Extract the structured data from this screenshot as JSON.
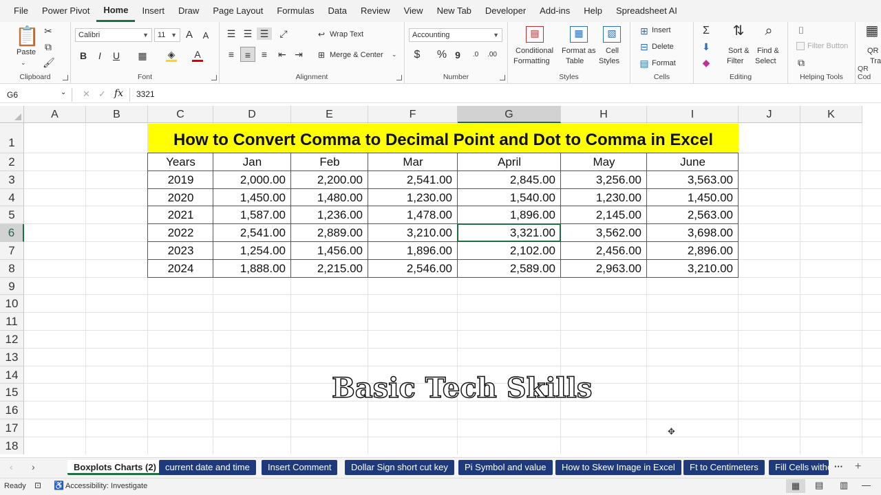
{
  "menu": [
    "File",
    "Power Pivot",
    "Home",
    "Insert",
    "Draw",
    "Page Layout",
    "Formulas",
    "Data",
    "Review",
    "View",
    "New Tab",
    "Developer",
    "Add-ins",
    "Help",
    "Spreadsheet AI"
  ],
  "menu_active": "Home",
  "ribbon": {
    "clipboard": {
      "paste": "Paste",
      "label": "Clipboard"
    },
    "font": {
      "name": "Calibri",
      "size": "11",
      "label": "Font",
      "bold": "B",
      "italic": "I",
      "underline": "U",
      "grow": "A",
      "shrink": "A"
    },
    "alignment": {
      "wrap": "Wrap Text",
      "merge": "Merge & Center",
      "label": "Alignment"
    },
    "number": {
      "format": "Accounting",
      "dollar": "$",
      "percent": "%",
      "comma": "9",
      "label": "Number"
    },
    "styles": {
      "conditional_1": "Conditional",
      "conditional_2": "Formatting",
      "format_table_1": "Format as",
      "format_table_2": "Table",
      "cell_styles_1": "Cell",
      "cell_styles_2": "Styles",
      "label": "Styles"
    },
    "cells": {
      "insert": "Insert",
      "delete": "Delete",
      "format": "Format",
      "label": "Cells"
    },
    "editing": {
      "sort_1": "Sort &",
      "sort_2": "Filter",
      "find_1": "Find &",
      "find_2": "Select",
      "label": "Editing"
    },
    "helping": {
      "filter_button": "Filter Button",
      "label": "Helping Tools"
    },
    "qr": {
      "label": "QR Cod",
      "btn_1": "QR",
      "btn_2": "Tra"
    }
  },
  "formula_bar": {
    "name_box": "G6",
    "fx": "fx",
    "value": "3321"
  },
  "columns": [
    "A",
    "B",
    "C",
    "D",
    "E",
    "F",
    "G",
    "H",
    "I",
    "J",
    "K"
  ],
  "rows": [
    "1",
    "2",
    "3",
    "4",
    "5",
    "6",
    "7",
    "8",
    "9",
    "10",
    "11",
    "12",
    "13",
    "14",
    "15",
    "16",
    "17",
    "18"
  ],
  "selected_col": "G",
  "selected_row": "6",
  "sheet": {
    "title": "How to Convert Comma to Decimal Point and Dot to Comma in Excel",
    "headers": [
      "Years",
      "Jan",
      "Feb",
      "Mar",
      "April",
      "May",
      "June"
    ],
    "data": [
      [
        "2019",
        "2,000.00",
        "2,200.00",
        "2,541.00",
        "2,845.00",
        "3,256.00",
        "3,563.00"
      ],
      [
        "2020",
        "1,450.00",
        "1,480.00",
        "1,230.00",
        "1,540.00",
        "1,230.00",
        "1,450.00"
      ],
      [
        "2021",
        "1,587.00",
        "1,236.00",
        "1,478.00",
        "1,896.00",
        "2,145.00",
        "2,563.00"
      ],
      [
        "2022",
        "2,541.00",
        "2,889.00",
        "3,210.00",
        "3,321.00",
        "3,562.00",
        "3,698.00"
      ],
      [
        "2023",
        "1,254.00",
        "1,456.00",
        "1,896.00",
        "2,102.00",
        "2,456.00",
        "2,896.00"
      ],
      [
        "2024",
        "1,888.00",
        "2,215.00",
        "2,546.00",
        "2,589.00",
        "2,963.00",
        "3,210.00"
      ]
    ]
  },
  "watermark": "Basic Tech Skills",
  "tabs": [
    "Boxplots Charts (2)",
    "current date and time",
    "Insert Comment",
    "Dollar Sign short cut key",
    "Pi Symbol and value",
    "How to Skew Image in Excel",
    "Ft to Centimeters",
    "Fill Cells witho"
  ],
  "active_tab": "Boxplots Charts (2)",
  "status": {
    "ready": "Ready",
    "accessibility": "Accessibility: Investigate"
  },
  "colors": {
    "accent": "#1e6e42",
    "tab_bg": "#1f3a7a",
    "title_bg": "#ffff00"
  }
}
